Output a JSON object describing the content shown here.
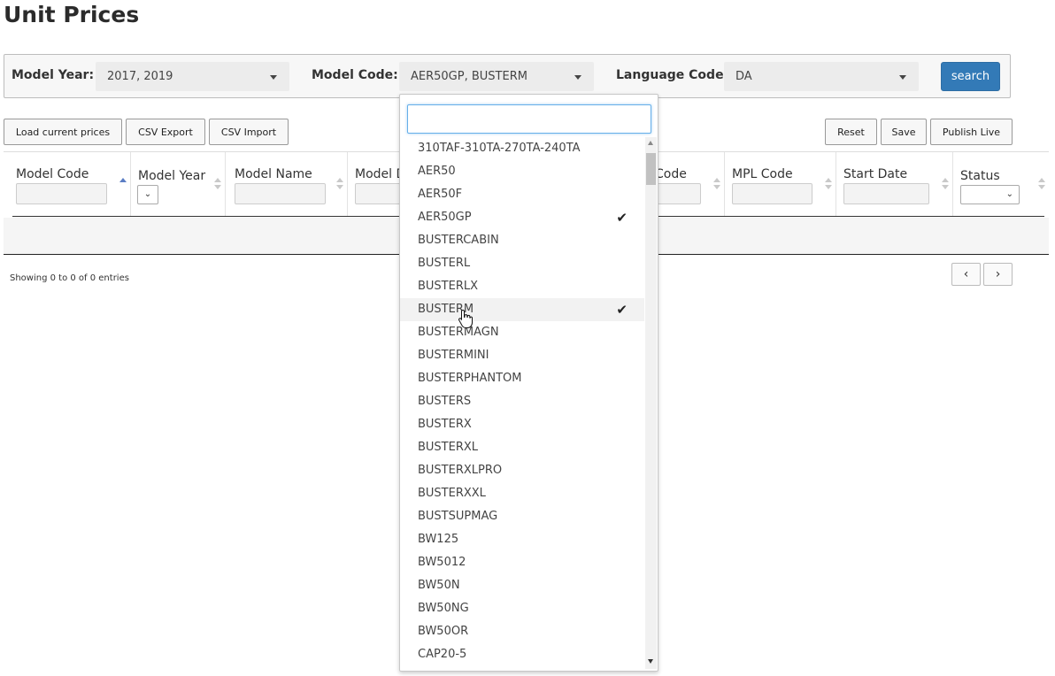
{
  "page": {
    "title": "Unit Prices"
  },
  "filters": {
    "model_year": {
      "label": "Model Year:",
      "value": "2017, 2019"
    },
    "model_code": {
      "label": "Model Code:",
      "value": "AER50GP, BUSTERM"
    },
    "language_code": {
      "label": "Language Code:",
      "value": "DA"
    },
    "search_label": "search"
  },
  "toolbar": {
    "load_current_prices": "Load current prices",
    "csv_export": "CSV Export",
    "csv_import": "CSV Import",
    "reset": "Reset",
    "save": "Save",
    "publish_live": "Publish Live"
  },
  "table": {
    "columns": [
      "Model Code",
      "Model Year",
      "Model Name",
      "Model D",
      "Code",
      "MPL Code",
      "Start Date",
      "Status"
    ],
    "info": "Showing 0 to 0 of 0 entries"
  },
  "dropdown": {
    "search_value": "",
    "items": [
      {
        "label": "310TAF-310TA-270TA-240TA",
        "selected": false
      },
      {
        "label": "AER50",
        "selected": false
      },
      {
        "label": "AER50F",
        "selected": false
      },
      {
        "label": "AER50GP",
        "selected": true
      },
      {
        "label": "BUSTERCABIN",
        "selected": false
      },
      {
        "label": "BUSTERL",
        "selected": false
      },
      {
        "label": "BUSTERLX",
        "selected": false
      },
      {
        "label": "BUSTERM",
        "selected": true
      },
      {
        "label": "BUSTERMAGN",
        "selected": false
      },
      {
        "label": "BUSTERMINI",
        "selected": false
      },
      {
        "label": "BUSTERPHANTOM",
        "selected": false
      },
      {
        "label": "BUSTERS",
        "selected": false
      },
      {
        "label": "BUSTERX",
        "selected": false
      },
      {
        "label": "BUSTERXL",
        "selected": false
      },
      {
        "label": "BUSTERXLPRO",
        "selected": false
      },
      {
        "label": "BUSTERXXL",
        "selected": false
      },
      {
        "label": "BUSTSUPMAG",
        "selected": false
      },
      {
        "label": "BW125",
        "selected": false
      },
      {
        "label": "BW5012",
        "selected": false
      },
      {
        "label": "BW50N",
        "selected": false
      },
      {
        "label": "BW50NG",
        "selected": false
      },
      {
        "label": "BW50OR",
        "selected": false
      },
      {
        "label": "CAP20-5",
        "selected": false
      }
    ]
  },
  "icons": {
    "check": "check-icon",
    "chevron_left": "chevron-left-icon",
    "chevron_right": "chevron-right-icon"
  },
  "colors": {
    "accent": "#337ab7"
  }
}
